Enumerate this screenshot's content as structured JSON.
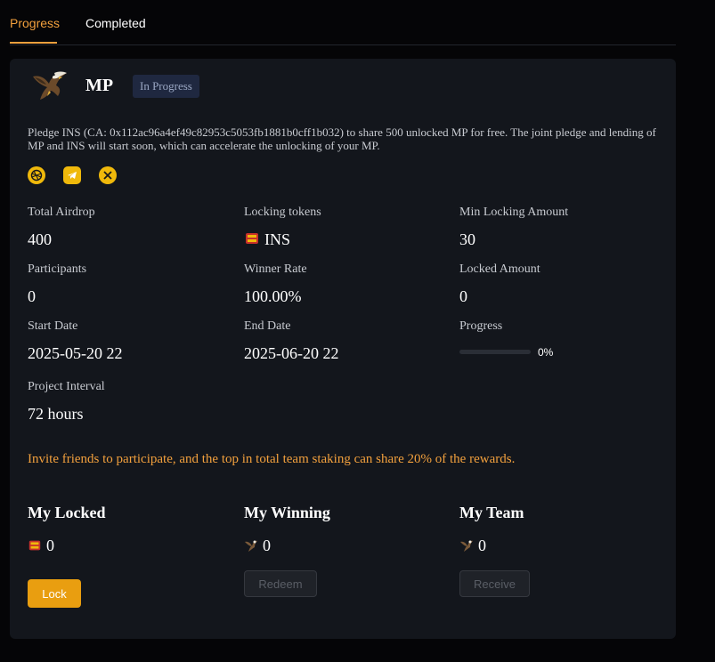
{
  "tabs": [
    {
      "label": "Progress",
      "active": true
    },
    {
      "label": "Completed",
      "active": false
    }
  ],
  "project": {
    "name": "MP",
    "status": "In Progress",
    "description": "Pledge INS (CA: 0x112ac96a4ef49c82953c5053fb1881b0cff1b032) to share 500 unlocked MP for free. The joint pledge and lending of MP and INS will start soon, which can accelerate the unlocking of your MP.",
    "socials": [
      "website-icon",
      "telegram-icon",
      "x-icon"
    ]
  },
  "stats": {
    "total_airdrop": {
      "label": "Total Airdrop",
      "value": "400"
    },
    "locking_tokens": {
      "label": "Locking tokens",
      "value": "INS"
    },
    "min_locking_amount": {
      "label": "Min Locking Amount",
      "value": "30"
    },
    "participants": {
      "label": "Participants",
      "value": "0"
    },
    "winner_rate": {
      "label": "Winner Rate",
      "value": "100.00%"
    },
    "locked_amount": {
      "label": "Locked Amount",
      "value": "0"
    },
    "start_date": {
      "label": "Start Date",
      "value": "2025-05-20 22"
    },
    "end_date": {
      "label": "End Date",
      "value": "2025-06-20 22"
    },
    "progress": {
      "label": "Progress",
      "value": "0%",
      "fraction": 0
    },
    "project_interval": {
      "label": "Project Interval",
      "value": "72 hours"
    }
  },
  "invite_text": "Invite friends to participate, and the top in total team staking can share 20% of the rewards.",
  "my_locked": {
    "title": "My Locked",
    "value": "0",
    "button": "Lock"
  },
  "my_winning": {
    "title": "My Winning",
    "value": "0",
    "button": "Redeem"
  },
  "my_team": {
    "title": "My Team",
    "value": "0",
    "button": "Receive"
  },
  "colors": {
    "accent": "#f2a03d",
    "button": "#e99e10",
    "card": "#13161c",
    "badge_bg": "#1f2840"
  }
}
